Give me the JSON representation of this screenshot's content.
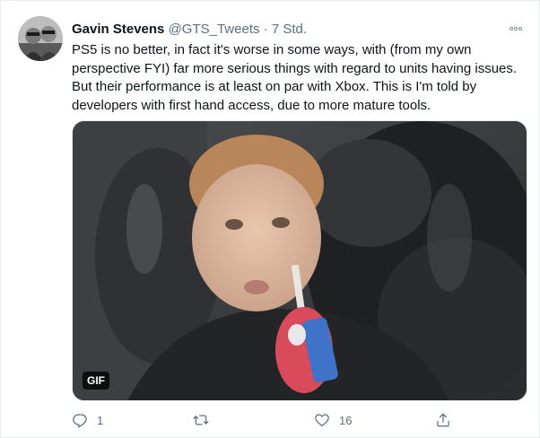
{
  "tweet": {
    "display_name": "Gavin Stevens",
    "handle": "@GTS_Tweets",
    "separator": "·",
    "time": "7 Std.",
    "more_icon": "ellipsis-icon",
    "text": "PS5 is no better, in fact it's worse in some ways, with (from my own perspective FYI) far more serious things with regard to units having issues. But their performance is at least on par with Xbox. This is I'm told by developers with first hand access, due to more mature tools.",
    "media": {
      "badge": "GIF"
    },
    "actions": {
      "reply": {
        "icon": "reply-icon",
        "count": "1"
      },
      "retweet": {
        "icon": "retweet-icon",
        "count": ""
      },
      "like": {
        "icon": "heart-icon",
        "count": "16"
      },
      "share": {
        "icon": "share-icon"
      }
    }
  },
  "colors": {
    "text_primary": "#0f1419",
    "text_secondary": "#5b7083",
    "border": "#e6ecf0"
  }
}
